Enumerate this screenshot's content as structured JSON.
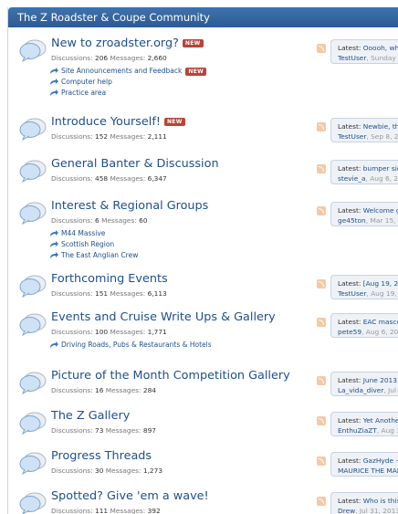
{
  "header": {
    "title": "The Z Roadster & Coupe Community"
  },
  "labels": {
    "discussions": "Discussions:",
    "messages": "Messages:",
    "latest": "Latest:",
    "new_badge": "NEW"
  },
  "forums": [
    {
      "title": "New to zroadster.org?",
      "new": true,
      "discussions": "206",
      "messages": "2,660",
      "subforums": [
        {
          "label": "Site Announcements and Feedback",
          "new": true
        },
        {
          "label": "Computer help"
        },
        {
          "label": "Practice area"
        }
      ],
      "latest_title": "Ooooh, wh",
      "latest_user": "TestUser",
      "latest_date": ", Sunday a"
    },
    {
      "title": "Introduce Yourself!",
      "new": true,
      "discussions": "152",
      "messages": "2,111",
      "subforums": [],
      "latest_title": "Newbie, th",
      "latest_user": "TestUser",
      "latest_date": ", Sep 8, 2"
    },
    {
      "title": "General Banter & Discussion",
      "discussions": "458",
      "messages": "6,347",
      "subforums": [],
      "latest_title": "bumper sid",
      "latest_user": "stevie_a",
      "latest_date": ", Aug 6, 2"
    },
    {
      "title": "Interest & Regional Groups",
      "discussions": "6",
      "messages": "60",
      "subforums": [
        {
          "label": "M44 Massive"
        },
        {
          "label": "Scottish Region"
        },
        {
          "label": "The East Anglian Crew"
        }
      ],
      "latest_title": "Welcome g",
      "latest_user": "ge45ton",
      "latest_date": ", Mar 15, 2"
    },
    {
      "title": "Forthcoming Events",
      "discussions": "151",
      "messages": "6,113",
      "subforums": [],
      "latest_title": "[Aug 19, 20",
      "latest_user": "TestUser",
      "latest_date": ", Aug 19, 2"
    },
    {
      "title": "Events and Cruise Write Ups & Gallery",
      "discussions": "100",
      "messages": "1,771",
      "subforums": [
        {
          "label": "Driving Roads, Pubs & Restaurants & Hotels"
        }
      ],
      "latest_title": "EAC masco",
      "latest_user": "pete59",
      "latest_date": ", Aug 6, 201"
    },
    {
      "title": "Picture of the Month Competition Gallery",
      "discussions": "16",
      "messages": "284",
      "subforums": [],
      "latest_title": "June 2013",
      "latest_user": "La_vida_diver",
      "latest_date": ", Jul"
    },
    {
      "title": "The Z Gallery",
      "discussions": "73",
      "messages": "897",
      "subforums": [],
      "latest_title": "Yet Anothe",
      "latest_user": "EnthuZiaZT",
      "latest_date": ", Aug 3"
    },
    {
      "title": "Progress Threads",
      "discussions": "30",
      "messages": "1,273",
      "subforums": [],
      "latest_title": "GazHyde -",
      "latest_user": "MAURICE THE MAR",
      "latest_date": ""
    },
    {
      "title": "Spotted? Give 'em a wave!",
      "discussions": "111",
      "messages": "392",
      "subforums": [],
      "latest_title": "Who is this",
      "latest_user": "Drew",
      "latest_date": ", Jul 31, 2013"
    }
  ],
  "colors": {
    "header": "#2f5f99",
    "link": "#1e4e8c",
    "badge": "#b8443a"
  },
  "icons": {
    "forum": "speech-bubble-icon",
    "subforum": "arrow-icon",
    "feed": "rss-icon"
  }
}
